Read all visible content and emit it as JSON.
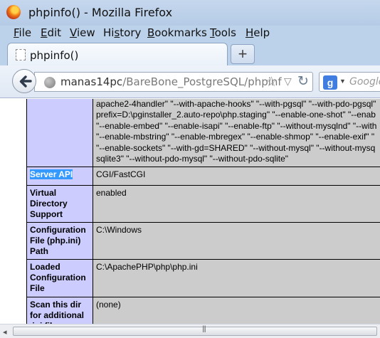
{
  "window": {
    "title": "phpinfo() - Mozilla Firefox"
  },
  "menubar": {
    "items": [
      {
        "pre": "",
        "u": "F",
        "post": "ile"
      },
      {
        "pre": "",
        "u": "E",
        "post": "dit"
      },
      {
        "pre": "",
        "u": "V",
        "post": "iew"
      },
      {
        "pre": "Hi",
        "u": "s",
        "post": "tory"
      },
      {
        "pre": "",
        "u": "B",
        "post": "ookmarks"
      },
      {
        "pre": "",
        "u": "T",
        "post": "ools"
      },
      {
        "pre": "",
        "u": "H",
        "post": "elp"
      }
    ]
  },
  "tabs": {
    "active_title": "phpinfo()",
    "new_tab_label": "+"
  },
  "navbar": {
    "url_host": "manas14pc",
    "url_path": "/BareBone_PostgreSQL/phpinf",
    "search_placeholder": "Google",
    "search_engine_letter": "g"
  },
  "phpinfo": {
    "configure_lines": [
      "apache2-4handler\" \"--with-apache-hooks\" \"--with-pgsql\" \"--with-pdo-pgsql\"",
      "prefix=D:\\pginstaller_2.auto-repo\\php.staging\" \"--enable-one-shot\" \"--enab",
      "\"--enable-embed\" \"--enable-isapi\" \"--enable-ftp\" \"--without-mysqlnd\" \"--with",
      "\"--enable-mbstring\" \"--enable-mbregex\" \"--enable-shmop\" \"--enable-exif\" \"",
      "\"--enable-sockets\" \"--with-gd=SHARED\" \"--without-mysql\" \"--without-mysq",
      "sqlite3\" \"--without-pdo-mysql\" \"--without-pdo-sqlite\""
    ],
    "rows": [
      {
        "key": "Server API",
        "value": "CGI/FastCGI",
        "selected": true
      },
      {
        "key": "Virtual Directory Support",
        "value": "enabled"
      },
      {
        "key": "Configuration File (php.ini) Path",
        "value": "C:\\Windows"
      },
      {
        "key": "Loaded Configuration File",
        "value": "C:\\ApachePHP\\php\\php.ini"
      },
      {
        "key": "Scan this dir for additional .ini files",
        "value": "(none)"
      }
    ]
  },
  "colors": {
    "key_cell": "#ccccff",
    "value_cell": "#cccccc",
    "selection": "#3399ff"
  }
}
